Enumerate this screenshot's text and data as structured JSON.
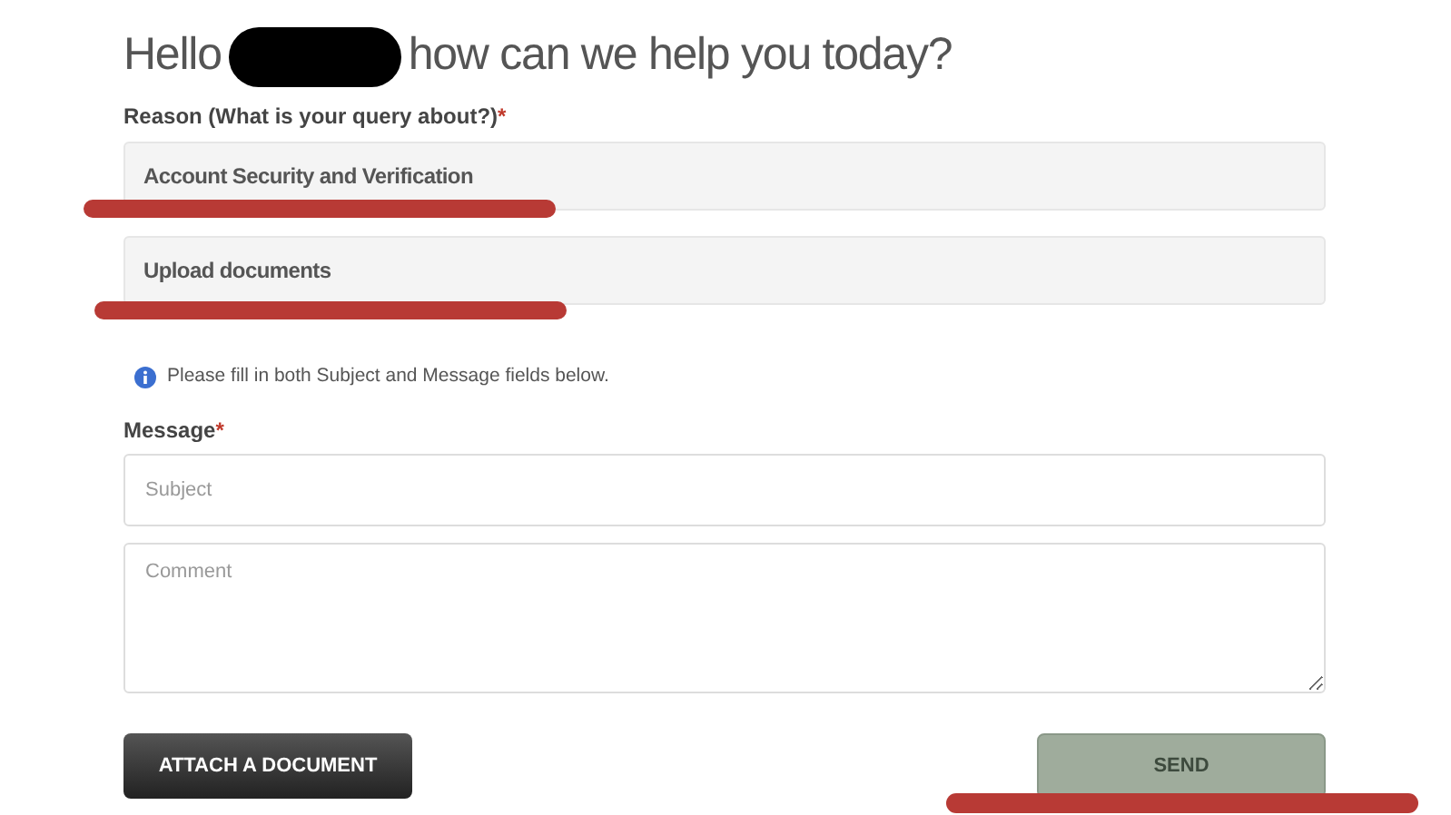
{
  "heading": {
    "greeting": "Hello",
    "question": "how can we help you today?"
  },
  "reason": {
    "label": "Reason (What is your query about?)",
    "required": "*",
    "selects": [
      {
        "value": "Account Security and Verification"
      },
      {
        "value": "Upload documents"
      }
    ]
  },
  "info": "Please fill in both Subject and Message fields below.",
  "message": {
    "label": "Message",
    "required": "*",
    "subject_placeholder": "Subject",
    "comment_placeholder": "Comment"
  },
  "buttons": [
    {
      "kind": "attach",
      "label": "ATTACH A DOCUMENT",
      "disabled": false
    },
    {
      "kind": "send",
      "label": "SEND",
      "disabled": true
    }
  ]
}
